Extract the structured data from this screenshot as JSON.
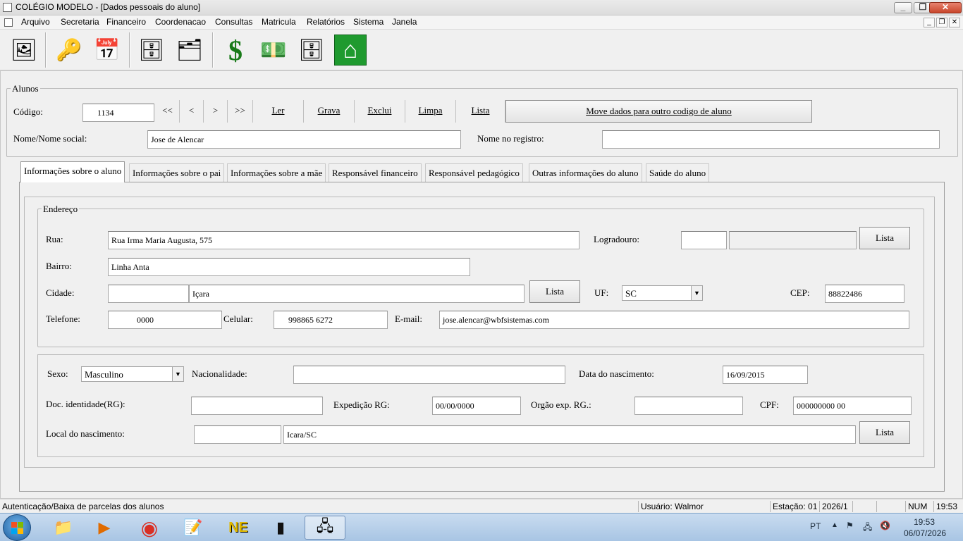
{
  "window": {
    "title": "COLÉGIO MODELO - [Dados pessoais do aluno]",
    "controls": {
      "minimize": "_",
      "restore": "❐",
      "close": "✕"
    }
  },
  "menu": [
    "Arquivo",
    "Secretaria",
    "Financeiro",
    "Coordenacao",
    "Consultas",
    "Matricula",
    "Relatórios",
    "Sistema",
    "Janela"
  ],
  "mdi_controls": [
    "_",
    "❐",
    "✕"
  ],
  "toolbar": [
    {
      "icon": "student-photo-icon",
      "glyph": "🖼",
      "color": "#2c7fd1"
    },
    {
      "icon": "keys-icon",
      "glyph": "🔑",
      "color": "#b8860b"
    },
    {
      "icon": "calendar-icon",
      "glyph": "📅",
      "color": "#333"
    },
    {
      "icon": "file-cabinet-icon",
      "glyph": "🗄",
      "color": "#3a8b8b"
    },
    {
      "icon": "documents-icon",
      "glyph": "🗂",
      "color": "#6b5b2a"
    },
    {
      "icon": "dollar-icon",
      "glyph": "$",
      "color": "#187a18"
    },
    {
      "icon": "money-icon",
      "glyph": "💵",
      "color": "#1e7a1e"
    },
    {
      "icon": "cabinet-m-icon",
      "glyph": "🗄",
      "color": "#3a8b8b"
    },
    {
      "icon": "home-icon",
      "glyph": "⌂",
      "color": "#c0392b"
    }
  ],
  "alunos": {
    "legend": "Alunos",
    "codigo_label": "Código:",
    "codigo_value": "1134",
    "nav": [
      "<<",
      "<",
      ">",
      ">>"
    ],
    "actions": [
      "Ler",
      "Grava",
      "Exclui",
      "Limpa",
      "Lista"
    ],
    "move_button": "Move dados para outro codigo de aluno",
    "nome_label": "Nome/Nome social:",
    "nome_value": "Jose de Alencar",
    "registro_label": "Nome no registro:",
    "registro_value": ""
  },
  "tabs": [
    "Informações sobre o aluno",
    "Informações sobre o pai",
    "Informações sobre a mãe",
    "Responsável financeiro",
    "Responsável pedagógico",
    "Outras informações do aluno",
    "Saúde do aluno"
  ],
  "endereco": {
    "legend": "Endereço",
    "rua_label": "Rua:",
    "rua_value": "Rua Irma Maria Augusta, 575",
    "logradouro_label": "Logradouro:",
    "logradouro_code": "",
    "logradouro_desc": "",
    "lista_label": "Lista",
    "bairro_label": "Bairro:",
    "bairro_value": "Linha Anta",
    "cidade_label": "Cidade:",
    "cidade_code": "",
    "cidade_value": "Içara",
    "cidade_lista": "Lista",
    "uf_label": "UF:",
    "uf_value": "SC",
    "cep_label": "CEP:",
    "cep_value": "88822486",
    "telefone_label": "Telefone:",
    "telefone_value": "0000",
    "celular_label": "Celular:",
    "celular_value": "998865 6272",
    "email_label": "E-mail:",
    "email_value": "jose.alencar@wbfsistemas.com"
  },
  "pessoal": {
    "sexo_label": "Sexo:",
    "sexo_value": "Masculino",
    "nacionalidade_label": "Nacionalidade:",
    "nacionalidade_value": "",
    "nascimento_label": "Data do nascimento:",
    "nascimento_value": "16/09/2015",
    "rg_label": "Doc. identidade(RG):",
    "rg_value": "",
    "expedicao_label": "Expedição RG:",
    "expedicao_value": "00/00/0000",
    "orgao_label": "Orgão exp. RG.:",
    "orgao_value": "",
    "cpf_label": "CPF:",
    "cpf_value": "000000000 00",
    "local_label": "Local do nascimento:",
    "local_code": "",
    "local_value": "Icara/SC",
    "local_lista": "Lista"
  },
  "statusbar": {
    "message": "Autenticação/Baixa de parcelas dos alunos",
    "usuario": "Usuário: Walmor",
    "estacao": "Estação: 01",
    "periodo": "2026/1",
    "num": "NUM",
    "time": "19:53"
  },
  "taskbar": {
    "apps": [
      {
        "icon": "file-explorer-icon",
        "glyph": "📁"
      },
      {
        "icon": "media-player-icon",
        "glyph": "▶"
      },
      {
        "icon": "chrome-icon",
        "glyph": "◉"
      },
      {
        "icon": "notepad-plus-icon",
        "glyph": "📝"
      },
      {
        "icon": "ne-app-icon",
        "glyph": "NE"
      },
      {
        "icon": "terminal-icon",
        "glyph": "▮"
      },
      {
        "icon": "network-app-icon",
        "glyph": "🖧"
      }
    ],
    "lang": "PT",
    "clock_time": "19:53",
    "clock_date": "06/07/2026"
  }
}
